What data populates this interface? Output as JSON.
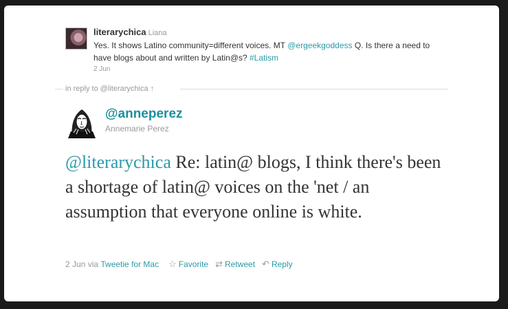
{
  "parent_tweet": {
    "screen_name": "literarychica",
    "full_name": "Liana",
    "text_before": "Yes. It shows Latino community=different voices. MT ",
    "mention": "@ergeekgoddess",
    "text_middle": " Q. Is there a need to have blogs about and written by Latin@s? ",
    "hashtag": "#Latism",
    "date": "2 Jun"
  },
  "in_reply_to": {
    "prefix": "in reply to ",
    "link": "@literarychica",
    "arrow": "↑"
  },
  "tweet": {
    "screen_name": "@anneperez",
    "full_name": "Annemarie Perez",
    "mention": "@literarychica",
    "text": " Re: latin@ blogs, I think there's been a shortage of latin@ voices on the 'net / an assumption that everyone online is white."
  },
  "meta": {
    "date": "2 Jun",
    "via": " via ",
    "client": "Tweetie for Mac",
    "favorite_label": "Favorite",
    "retweet_label": "Retweet",
    "reply_label": "Reply"
  },
  "colors": {
    "link": "#2a9aa7",
    "screen_name": "#1f8f9b",
    "background": "#1a1a1a"
  }
}
